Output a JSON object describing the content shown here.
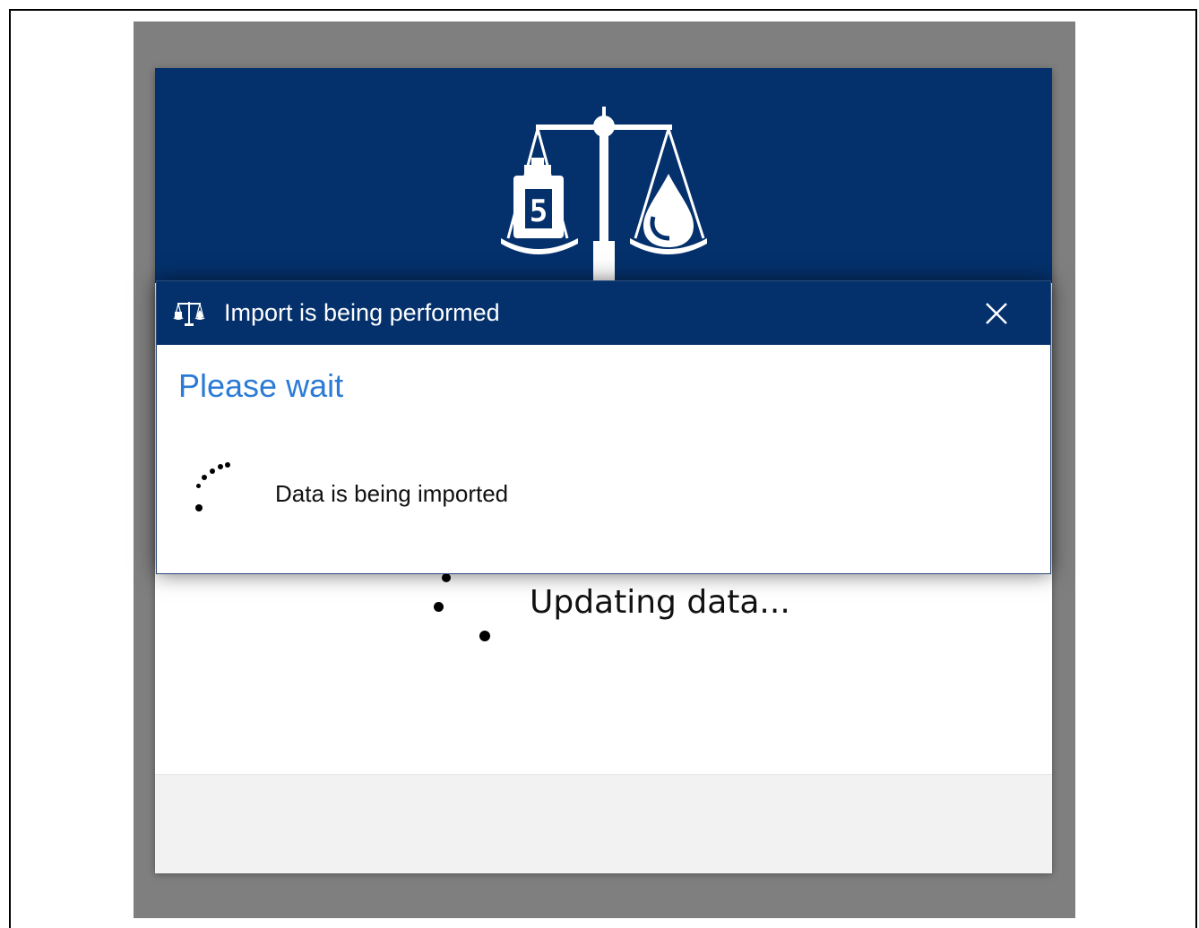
{
  "app": {
    "status_text": "Updating data..."
  },
  "dialog": {
    "title": "Import is being performed",
    "heading": "Please wait",
    "message": "Data is being imported",
    "close_icon": "close-icon",
    "title_icon": "balance-scale-icon"
  },
  "colors": {
    "header_bg": "#04316c",
    "heading_text": "#2b7bd6",
    "overlay": "#7f7f7f",
    "footer_bg": "#f2f2f2"
  },
  "icons": {
    "logo": "scale-weight-water-logo",
    "spinner": "loading-spinner-icon"
  }
}
